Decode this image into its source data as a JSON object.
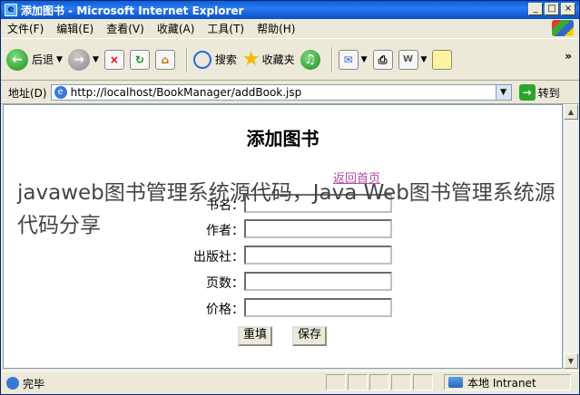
{
  "window": {
    "title": "添加图书 - Microsoft Internet Explorer",
    "buttons": [
      "_",
      "□",
      "×"
    ]
  },
  "menu": [
    "文件(F)",
    "编辑(E)",
    "查看(V)",
    "收藏(A)",
    "工具(T)",
    "帮助(H)"
  ],
  "toolbar": {
    "back": "后退",
    "search": "搜索",
    "favorites": "收藏夹",
    "more": "»"
  },
  "address": {
    "label": "地址(D)",
    "url": "http://localhost/BookManager/addBook.jsp",
    "go": "转到"
  },
  "page": {
    "heading": "添加图书",
    "back_link": "返回首页",
    "fields": [
      {
        "label": "书名：",
        "value": ""
      },
      {
        "label": "作者：",
        "value": ""
      },
      {
        "label": "出版社：",
        "value": ""
      },
      {
        "label": "页数：",
        "value": ""
      },
      {
        "label": "价格：",
        "value": ""
      }
    ],
    "reset_label": "重填",
    "save_label": "保存"
  },
  "overlay_caption": "javaweb图书管理系统源代码，Java Web图书管理系统源代码分享",
  "status": {
    "text": "完毕",
    "zone": "本地 Intranet"
  }
}
